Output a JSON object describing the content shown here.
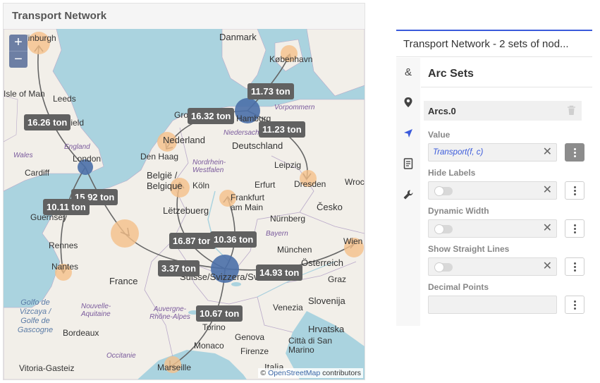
{
  "map_widget": {
    "title": "Transport Network",
    "zoom_in": "+",
    "zoom_out": "−",
    "attribution_prefix": "© ",
    "attribution_link": "OpenStreetMap",
    "attribution_suffix": " contributors",
    "arc_labels": [
      "16.26 ton",
      "11.73 ton",
      "16.32 ton",
      "11.23 ton",
      "15.92 ton",
      "10.11 ton",
      "16.87 ton",
      "10.36 ton",
      "3.37 ton",
      "14.93 ton",
      "10.67 ton"
    ],
    "places": [
      "Edinburgh",
      "Danmark",
      "København",
      "Leeds",
      "Isle of Man",
      "Hamburg",
      "Field",
      "Groningen",
      "Vorpommern",
      "Niedersachsen",
      "Nederland",
      "Den Haag",
      "Deutschland",
      "Wales",
      "England",
      "London",
      "Cardiff",
      "Nordrhein-Westfalen",
      "Leipzig",
      "Dresden",
      "België / Belgique",
      "Köln",
      "Erfurt",
      "Wrocław",
      "Frankfurt am Main",
      "Česko",
      "Guernsey",
      "Lëtzebuerg",
      "Nürnberg",
      "Rennes",
      "Bayern",
      "Wien",
      "München",
      "Nantes",
      "Österreich",
      "France",
      "Suisse/Svizzera/Svizra",
      "Graz",
      "Golfo de Vizcaya / Golfe de Gascogne",
      "Nouvelle-Aquitaine",
      "Auvergne-Rhône-Alpes",
      "Venezia",
      "Slovenija",
      "Hrvatska",
      "Bordeaux",
      "Torino",
      "Genova",
      "Monaco",
      "Firenze",
      "Città di San Marino",
      "Occitanie",
      "Marseille",
      "Italia",
      "Vitoria-Gasteiz"
    ]
  },
  "panel": {
    "title": "Transport Network - 2 sets of nod...",
    "section_title": "Arc Sets",
    "arc_header": "Arcs.0",
    "properties": [
      {
        "label": "Value",
        "value": "Transport(f, c)",
        "kind": "text"
      },
      {
        "label": "Hide Labels",
        "value": "",
        "kind": "toggle"
      },
      {
        "label": "Dynamic Width",
        "value": "",
        "kind": "toggle"
      },
      {
        "label": "Show Straight Lines",
        "value": "",
        "kind": "toggle"
      },
      {
        "label": "Decimal Points",
        "value": "",
        "kind": "empty"
      }
    ],
    "clear_glyph": "✕",
    "tab_icons": [
      "ampersand-icon",
      "map-pin-icon",
      "navigation-arrow-icon",
      "document-icon",
      "wrench-icon"
    ]
  },
  "colors": {
    "accent": "#3b5bdb",
    "supply_node": "#4a6fa8",
    "demand_node": "#f5c08a",
    "arc_label_bg": "#616161"
  }
}
